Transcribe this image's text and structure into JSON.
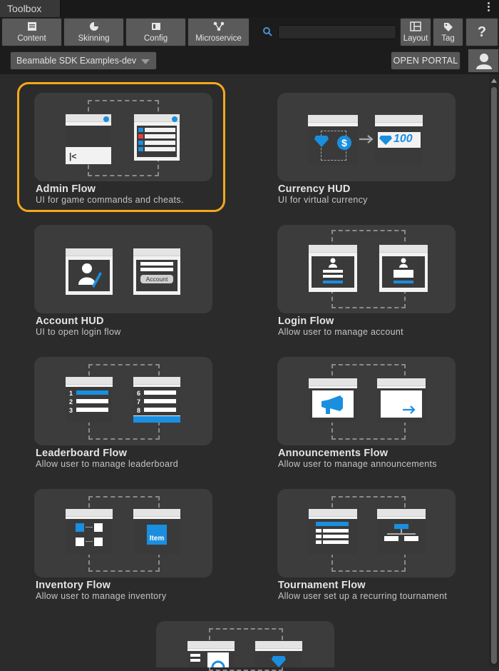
{
  "window": {
    "tab_label": "Toolbox"
  },
  "toolbar": {
    "buttons": [
      {
        "label": "Content",
        "icon": "content-icon"
      },
      {
        "label": "Skinning",
        "icon": "skinning-icon"
      },
      {
        "label": "Config",
        "icon": "config-icon"
      },
      {
        "label": "Microservice",
        "icon": "microservice-icon"
      }
    ],
    "search_placeholder": "",
    "layout_label": "Layout",
    "tag_label": "Tag",
    "help_label": "?"
  },
  "subbar": {
    "realm": "Beamable SDK Examples-dev",
    "open_portal": "OPEN PORTAL"
  },
  "colors": {
    "accent": "#f4a81c",
    "brand_blue": "#1a8fe0",
    "card_bg": "#3c3c3c"
  },
  "cards": [
    {
      "title": "Admin Flow",
      "description": "UI for game commands and cheats.",
      "selected": true
    },
    {
      "title": "Currency HUD",
      "description": "UI for virtual currency",
      "amount": "100"
    },
    {
      "title": "Account HUD",
      "description": "UI to open login flow",
      "button_text": "Account"
    },
    {
      "title": "Login Flow",
      "description": "Allow user to manage account"
    },
    {
      "title": "Leaderboard Flow",
      "description": "Allow user to manage leaderboard",
      "ranks_left": [
        "1",
        "2",
        "3"
      ],
      "ranks_right": [
        "6",
        "7",
        "8"
      ]
    },
    {
      "title": "Announcements Flow",
      "description": "Allow user to manage announcements"
    },
    {
      "title": "Inventory Flow",
      "description": "Allow user to manage inventory",
      "item_text": "Item"
    },
    {
      "title": "Tournament Flow",
      "description": "Allow user set up a recurring tournament"
    }
  ]
}
